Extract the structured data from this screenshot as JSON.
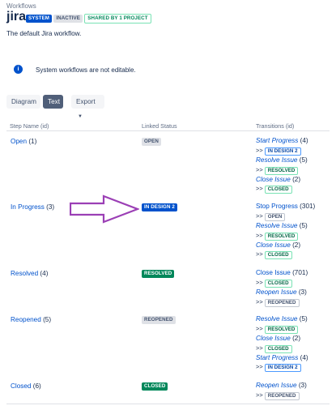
{
  "header": {
    "breadcrumb": "Workflows",
    "title": "jira",
    "badges": [
      "SYSTEM",
      "INACTIVE",
      "SHARED BY 1 PROJECT"
    ],
    "description": "The default Jira workflow."
  },
  "notice": {
    "icon": "info-icon",
    "text": "System workflows are not editable."
  },
  "toolbar": {
    "diagram_label": "Diagram",
    "text_label": "Text",
    "export_label": "Export"
  },
  "table": {
    "headers": [
      "Step Name (id)",
      "Linked Status",
      "Transitions (id)"
    ],
    "rows": [
      {
        "step": "Open",
        "id": "(1)",
        "status": "OPEN",
        "transitions": [
          {
            "name": "Start Progress",
            "id": "(4)",
            "target": "IN DESIGN 2"
          },
          {
            "name": "Resolve Issue",
            "id": "(5)",
            "target": "RESOLVED"
          },
          {
            "name": "Close Issue",
            "id": "(2)",
            "target": "CLOSED"
          }
        ]
      },
      {
        "step": "In Progress",
        "id": "(3)",
        "status": "IN DESIGN 2",
        "transitions": [
          {
            "name": "Stop Progress",
            "id": "(301)",
            "target": "OPEN"
          },
          {
            "name": "Resolve Issue",
            "id": "(5)",
            "target": "RESOLVED"
          },
          {
            "name": "Close Issue",
            "id": "(2)",
            "target": "CLOSED"
          }
        ]
      },
      {
        "step": "Resolved",
        "id": "(4)",
        "status": "RESOLVED",
        "transitions": [
          {
            "name": "Close Issue",
            "id": "(701)",
            "target": "CLOSED"
          },
          {
            "name": "Reopen Issue",
            "id": "(3)",
            "target": "REOPENED"
          }
        ]
      },
      {
        "step": "Reopened",
        "id": "(5)",
        "status": "REOPENED",
        "transitions": [
          {
            "name": "Resolve Issue",
            "id": "(5)",
            "target": "RESOLVED"
          },
          {
            "name": "Close Issue",
            "id": "(2)",
            "target": "CLOSED"
          },
          {
            "name": "Start Progress",
            "id": "(4)",
            "target": "IN DESIGN 2"
          }
        ]
      },
      {
        "step": "Closed",
        "id": "(6)",
        "status": "CLOSED",
        "transitions": [
          {
            "name": "Reopen Issue",
            "id": "(3)",
            "target": "REOPENED"
          }
        ]
      }
    ]
  },
  "annotation": {
    "arrow_color": "#9b3fb5"
  },
  "colors": {
    "accent": "#0052cc",
    "success": "#00875a"
  }
}
